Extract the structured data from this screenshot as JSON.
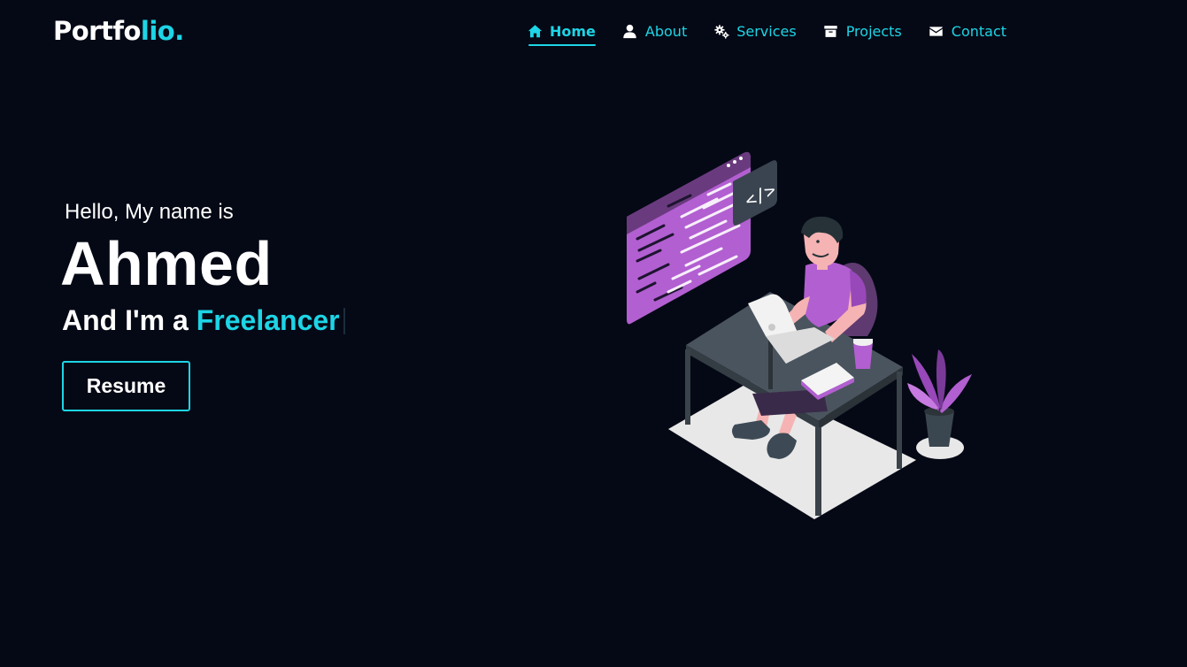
{
  "header": {
    "logo_main": "Portfo",
    "logo_accent": "lio."
  },
  "nav": {
    "items": [
      {
        "label": "Home",
        "icon": "home-icon",
        "active": true
      },
      {
        "label": "About",
        "icon": "user-icon",
        "active": false
      },
      {
        "label": "Services",
        "icon": "gears-icon",
        "active": false
      },
      {
        "label": "Projects",
        "icon": "archive-icon",
        "active": false
      },
      {
        "label": "Contact",
        "icon": "envelope-icon",
        "active": false
      }
    ]
  },
  "hero": {
    "greeting": "Hello, My name is",
    "name": "Ahmed",
    "role_prefix": "And I'm a",
    "role_typed": "Freelancer",
    "resume_label": "Resume",
    "illustration": "developer-at-desk-illustration"
  },
  "colors": {
    "background": "#050915",
    "accent": "#1dd5e6",
    "text": "#ffffff",
    "illustration_purple": "#b25fd1"
  }
}
